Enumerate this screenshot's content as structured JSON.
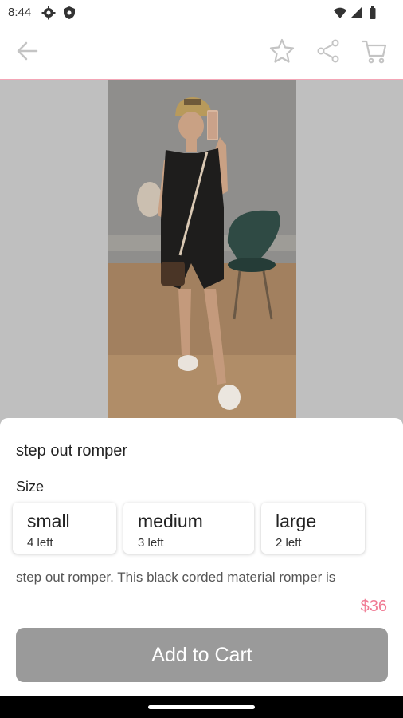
{
  "status_bar": {
    "time": "8:44",
    "icons": [
      "settings-gear-icon",
      "shield-icon",
      "wifi-icon",
      "signal-icon",
      "battery-icon"
    ]
  },
  "app_bar": {
    "icons": [
      "back-arrow-icon",
      "star-icon",
      "share-icon",
      "cart-icon"
    ]
  },
  "product": {
    "title": "step out romper",
    "size_heading": "Size",
    "sizes": [
      {
        "name": "small",
        "stock": "4 left"
      },
      {
        "name": "medium",
        "stock": "3 left"
      },
      {
        "name": "large",
        "stock": "2 left"
      }
    ],
    "description": "step out romper. This black corded material romper is",
    "price": "$36"
  },
  "actions": {
    "add_to_cart": "Add to Cart"
  },
  "colors": {
    "accent_pink": "#f07a93",
    "divider_pink": "#f3a6b6",
    "button_gray": "#9a9a9a"
  }
}
